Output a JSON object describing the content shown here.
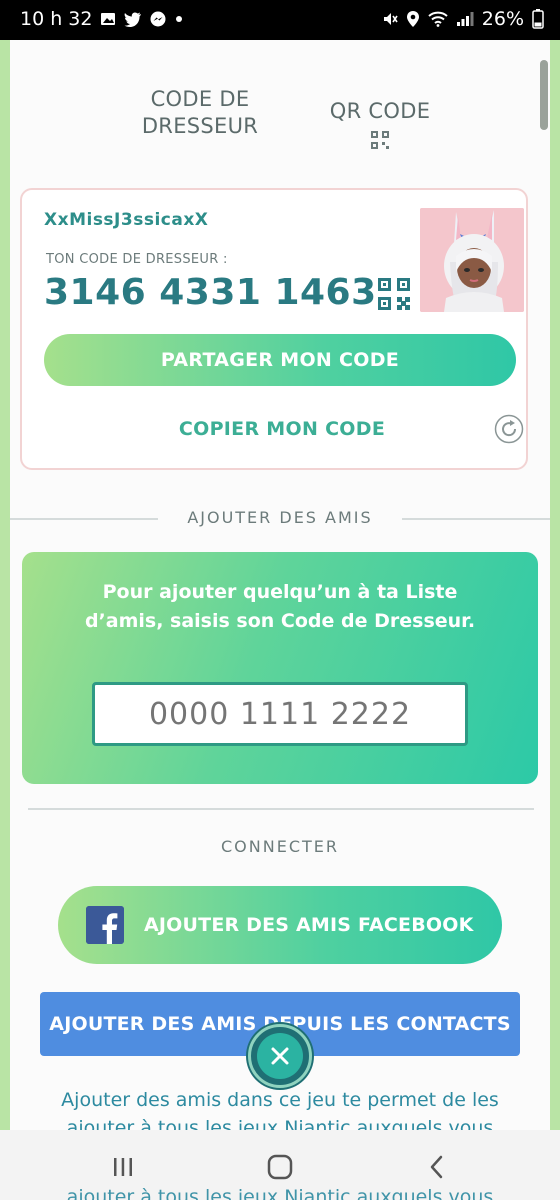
{
  "status_bar": {
    "time": "10 h 32",
    "battery": "26%",
    "left_icons": [
      "gallery-icon",
      "twitter-icon",
      "messenger-icon",
      "dot-icon"
    ],
    "right_icons": [
      "mute-icon",
      "location-icon",
      "wifi-icon",
      "signal-icon"
    ]
  },
  "tabs": {
    "trainer_code": "CODE DE DRESSEUR",
    "qr_code": "QR CODE"
  },
  "trainer": {
    "name": "XxMissJ3ssicaxX",
    "code_label": "TON CODE DE DRESSEUR :",
    "code": "3146 4331 1463",
    "share_label": "PARTAGER MON CODE",
    "copy_label": "COPIER MON CODE"
  },
  "add_friends": {
    "section_title": "AJOUTER DES AMIS",
    "instructions": "Pour ajouter quelqu’un à ta Liste d’amis, saisis son Code de Dresseur.",
    "input_placeholder": "0000 1111 2222"
  },
  "connect": {
    "section_title": "CONNECTER",
    "facebook_label": "AJOUTER DES AMIS FACEBOOK",
    "contacts_label": "AJOUTER DES AMIS DEPUIS LES CONTACTS"
  },
  "info": {
    "text": "Ajouter des amis dans ce jeu te permet de les ajouter à tous les jeux Niantic auxquels vous",
    "ghost_text": "ajouter à tous les jeux Niantic auxquels vous"
  },
  "colors": {
    "accent_green": "#4fd0a0",
    "code_teal": "#2a7a82",
    "contacts_blue": "#4f8de0",
    "facebook_blue": "#3b5998"
  }
}
